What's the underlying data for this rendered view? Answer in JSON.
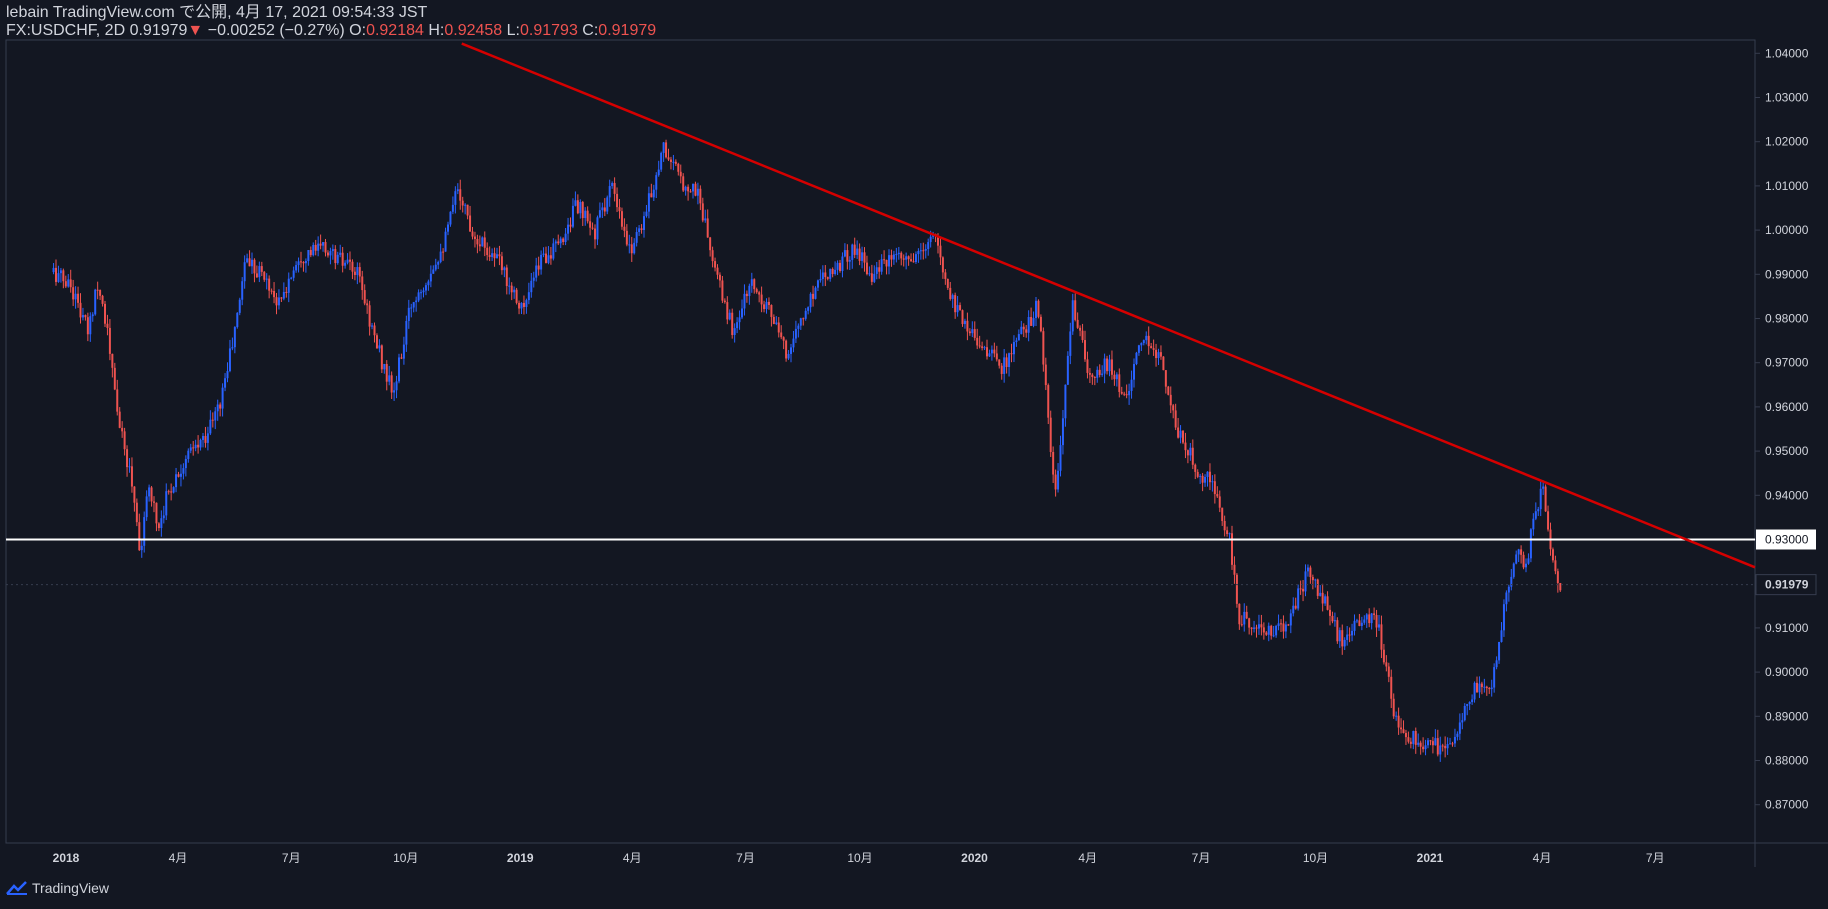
{
  "header": {
    "publisher": "lebain TradingView.com で公開, 4月 17, 2021 09:54:33 JST",
    "symbol": "FX:USDCHF, 2D",
    "last": "0.91979",
    "change": "−0.00252 (−0.27%)",
    "o_label": "O:",
    "o_value": "0.92184",
    "h_label": "H:",
    "h_value": "0.92458",
    "l_label": "L:",
    "l_value": "0.91793",
    "c_label": "C:",
    "c_value": "0.91979"
  },
  "branding": {
    "name": "TradingView",
    "icon": "tradingview-cloud-icon"
  },
  "colors": {
    "background": "#131722",
    "up": "#2962ff",
    "down": "#ef5350",
    "trendline": "#d50000",
    "level": "#ffffff",
    "text": "#d1d4dc",
    "axis_line": "#363c4e"
  },
  "chart_data": {
    "type": "candlestick",
    "symbol": "FX:USDCHF",
    "interval": "2D",
    "ylim": [
      0.865,
      1.0415
    ],
    "y_ticks": [
      "1.04000",
      "1.03000",
      "1.02000",
      "1.01000",
      "1.00000",
      "0.99000",
      "0.98000",
      "0.97000",
      "0.96000",
      "0.95000",
      "0.94000",
      "0.93000",
      "0.92000",
      "0.91000",
      "0.90000",
      "0.89000",
      "0.88000",
      "0.87000"
    ],
    "x_ticks": [
      "2018",
      "4月",
      "7月",
      "10月",
      "2019",
      "4月",
      "7月",
      "10月",
      "2020",
      "4月",
      "7月",
      "10月",
      "2021",
      "4月",
      "7月"
    ],
    "horizontal_level": {
      "value": 0.93,
      "label": "0.93000"
    },
    "last_price": {
      "value": 0.91979,
      "label": "0.91979"
    },
    "trendline": {
      "from": [
        "2018-11-15",
        1.0422
      ],
      "to": [
        "2021-07-26",
        0.93
      ]
    },
    "price_path": [
      [
        "2017-12-22",
        0.9905
      ],
      [
        "2018-01-05",
        0.9875
      ],
      [
        "2018-01-12",
        0.982
      ],
      [
        "2018-01-19",
        0.9765
      ],
      [
        "2018-01-26",
        0.989
      ],
      [
        "2018-02-02",
        0.9795
      ],
      [
        "2018-02-09",
        0.9635
      ],
      [
        "2018-02-16",
        0.951
      ],
      [
        "2018-02-23",
        0.9432
      ],
      [
        "2018-03-02",
        0.927
      ],
      [
        "2018-03-09",
        0.943
      ],
      [
        "2018-03-16",
        0.9325
      ],
      [
        "2018-03-23",
        0.94
      ],
      [
        "2018-04-06",
        0.948
      ],
      [
        "2018-04-20",
        0.952
      ],
      [
        "2018-05-04",
        0.96
      ],
      [
        "2018-05-18",
        0.979
      ],
      [
        "2018-05-25",
        0.994
      ],
      [
        "2018-06-08",
        0.99
      ],
      [
        "2018-06-22",
        0.983
      ],
      [
        "2018-07-06",
        0.994
      ],
      [
        "2018-07-27",
        0.996
      ],
      [
        "2018-08-10",
        0.993
      ],
      [
        "2018-08-24",
        0.9895
      ],
      [
        "2018-09-07",
        0.9745
      ],
      [
        "2018-09-21",
        0.9625
      ],
      [
        "2018-10-05",
        0.983
      ],
      [
        "2018-10-19",
        0.99
      ],
      [
        "2018-11-02",
        0.998
      ],
      [
        "2018-11-12",
        1.01
      ],
      [
        "2018-11-23",
        1.0
      ],
      [
        "2018-12-14",
        0.993
      ],
      [
        "2019-01-04",
        0.982
      ],
      [
        "2019-01-18",
        0.994
      ],
      [
        "2019-02-01",
        0.996
      ],
      [
        "2019-02-15",
        1.006
      ],
      [
        "2019-03-01",
        0.999
      ],
      [
        "2019-03-15",
        1.01
      ],
      [
        "2019-03-29",
        0.995
      ],
      [
        "2019-04-12",
        1.004
      ],
      [
        "2019-04-26",
        1.019
      ],
      [
        "2019-05-10",
        1.011
      ],
      [
        "2019-05-24",
        1.0085
      ],
      [
        "2019-06-07",
        0.99
      ],
      [
        "2019-06-21",
        0.977
      ],
      [
        "2019-07-05",
        0.988
      ],
      [
        "2019-07-19",
        0.983
      ],
      [
        "2019-08-02",
        0.972
      ],
      [
        "2019-08-16",
        0.98
      ],
      [
        "2019-08-30",
        0.99
      ],
      [
        "2019-09-13",
        0.992
      ],
      [
        "2019-09-27",
        0.996
      ],
      [
        "2019-10-11",
        0.99
      ],
      [
        "2019-10-25",
        0.993
      ],
      [
        "2019-11-15",
        0.993
      ],
      [
        "2019-11-29",
        0.999
      ],
      [
        "2019-12-13",
        0.985
      ],
      [
        "2019-12-27",
        0.978
      ],
      [
        "2020-01-10",
        0.973
      ],
      [
        "2020-01-24",
        0.969
      ],
      [
        "2020-02-07",
        0.976
      ],
      [
        "2020-02-21",
        0.983
      ],
      [
        "2020-03-06",
        0.939
      ],
      [
        "2020-03-13",
        0.96
      ],
      [
        "2020-03-20",
        0.984
      ],
      [
        "2020-04-03",
        0.965
      ],
      [
        "2020-04-17",
        0.97
      ],
      [
        "2020-05-01",
        0.962
      ],
      [
        "2020-05-15",
        0.975
      ],
      [
        "2020-05-29",
        0.972
      ],
      [
        "2020-06-12",
        0.954
      ],
      [
        "2020-06-26",
        0.947
      ],
      [
        "2020-07-10",
        0.942
      ],
      [
        "2020-07-24",
        0.93
      ],
      [
        "2020-07-31",
        0.912
      ],
      [
        "2020-08-14",
        0.911
      ],
      [
        "2020-08-28",
        0.908
      ],
      [
        "2020-09-11",
        0.913
      ],
      [
        "2020-09-25",
        0.923
      ],
      [
        "2020-10-09",
        0.915
      ],
      [
        "2020-10-23",
        0.906
      ],
      [
        "2020-11-06",
        0.912
      ],
      [
        "2020-11-20",
        0.911
      ],
      [
        "2020-12-04",
        0.89
      ],
      [
        "2020-12-18",
        0.885
      ],
      [
        "2021-01-08",
        0.883
      ],
      [
        "2021-01-22",
        0.886
      ],
      [
        "2021-02-05",
        0.896
      ],
      [
        "2021-02-19",
        0.896
      ],
      [
        "2021-03-05",
        0.92
      ],
      [
        "2021-03-12",
        0.929
      ],
      [
        "2021-03-19",
        0.924
      ],
      [
        "2021-03-26",
        0.935
      ],
      [
        "2021-04-02",
        0.942
      ],
      [
        "2021-04-09",
        0.927
      ],
      [
        "2021-04-16",
        0.9198
      ]
    ]
  }
}
